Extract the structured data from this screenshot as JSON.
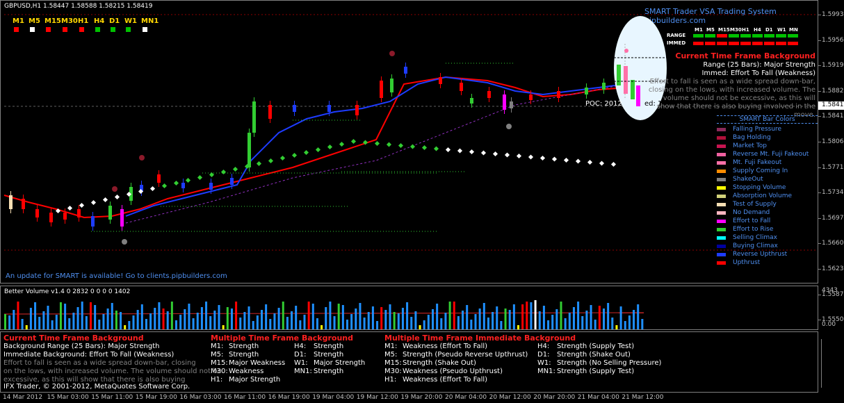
{
  "chart": {
    "symbol_header": "GBPUSD,H1  1.58447 1.58588 1.58215 1.58419",
    "update_notice": "An update for SMART is available! Go to clients.pipbuilders.com",
    "branding": "SMART Trader VSA Trading System pipbuilders.com",
    "poc_text": "POC: 2012",
    "poc_text2": "ed: 1.58546",
    "timeframes": [
      {
        "label": "M1",
        "color": "#ff0000"
      },
      {
        "label": "M5",
        "color": "#ffffff"
      },
      {
        "label": "M15",
        "color": "#ff0000"
      },
      {
        "label": "M30",
        "color": "#ff0000"
      },
      {
        "label": "H1",
        "color": "#ff0000"
      },
      {
        "label": "H4",
        "color": "#00c000"
      },
      {
        "label": "D1",
        "color": "#00c000"
      },
      {
        "label": "W1",
        "color": "#00c000"
      },
      {
        "label": "MN1",
        "color": "#ffffff"
      }
    ]
  },
  "matrix": {
    "headers": [
      "M1",
      "M5",
      "M15",
      "M30",
      "H1",
      "H4",
      "D1",
      "W1",
      "MN"
    ],
    "range_label": "RANGE",
    "immed_label": "IMMED",
    "range_colors": [
      "#00c000",
      "#00c000",
      "#ff0000",
      "#00c000",
      "#00c000",
      "#00c000",
      "#00c000",
      "#00c000",
      "#00c000"
    ],
    "immed_colors": [
      "#ff0000",
      "#ff0000",
      "#ff0000",
      "#ff0000",
      "#ff0000",
      "#ff0000",
      "#ff0000",
      "#ff0000",
      "#ff0000"
    ]
  },
  "background": {
    "title": "Current Time Frame Background",
    "range": "Range (25 Bars): Major Strength",
    "immed": "Immed: Effort To Fall (Weakness)",
    "desc1": "Effort to fall is seen as a wide spread down-bar,",
    "desc2": "closing on the lows, with increased volume. The",
    "desc3": "volume should not be excessive, as this will",
    "desc4": "show that there is also buying involved in the",
    "desc5": "move."
  },
  "legend": {
    "title": "SMART Bar Colors",
    "items": [
      {
        "label": "Falling Pressure",
        "color": "#8b2a5a"
      },
      {
        "label": "Bag Holding",
        "color": "#b0103a"
      },
      {
        "label": "Market Top",
        "color": "#c81450"
      },
      {
        "label": "Reverse Mt. Fuji Fakeout",
        "color": "#f060a0"
      },
      {
        "label": "Mt. Fuji Fakeout",
        "color": "#ff70a8"
      },
      {
        "label": "Supply Coming In",
        "color": "#ff8c00"
      },
      {
        "label": "ShakeOut",
        "color": "#808080"
      },
      {
        "label": "Stopping Volume",
        "color": "#ffff00"
      },
      {
        "label": "Absorption Volume",
        "color": "#d2d27a"
      },
      {
        "label": "Test of Supply",
        "color": "#f5deb3"
      },
      {
        "label": "No Demand",
        "color": "#ffb6c1"
      },
      {
        "label": "Effort to Fall",
        "color": "#ff00ff"
      },
      {
        "label": "Effort to Rise",
        "color": "#32cd32"
      },
      {
        "label": "Selling Climax",
        "color": "#00ffff"
      },
      {
        "label": "Buying Climax",
        "color": "#0000a0"
      },
      {
        "label": "Reverse Upthrust",
        "color": "#1e3cff"
      },
      {
        "label": "Upthrust",
        "color": "#ff0000"
      }
    ]
  },
  "price_axis": [
    "1.59930",
    "1.59565",
    "1.59190",
    "1.58820",
    "1.58419",
    "1.58060",
    "1.57710",
    "1.57340",
    "1.56970",
    "1.56600",
    "1.56230",
    "1.55870",
    "1.55500"
  ],
  "volume": {
    "title": "Better Volume v1.4 0 2832 0 0 0 0 1402",
    "scale_top": "4343",
    "scale_bottom": "0.00"
  },
  "info": {
    "ctf_title": "Current Time Frame Background",
    "ctf_l1": "Background Range (25 Bars): Major Strength",
    "ctf_l2": "Immediate Background: Effort To Fall (Weakness)",
    "ctf_l3": "Effort to fall is seen as a wide spread down-bar, closing",
    "ctf_l4": "on the lows, with increased volume. The volume should not be",
    "ctf_l5": "excessive, as this will show that there is also buying",
    "copyright": "IFX Trader, © 2001-2012, MetaQuotes Software Corp.",
    "mtf_title": "Multiple Time Frame Background",
    "mtf": [
      [
        "M1:",
        "Strength",
        "H4:",
        "Strength"
      ],
      [
        "M5:",
        "Strength",
        "D1:",
        "Strength"
      ],
      [
        "M15:",
        "Major Weakness",
        "W1:",
        "Major Strength"
      ],
      [
        "M30:",
        "Weakness",
        "MN1:",
        "Strength"
      ],
      [
        "H1:",
        "Major Strength",
        "",
        ""
      ]
    ],
    "mtfi_title": "Multiple Time Frame Immediate Background",
    "mtfi": [
      [
        "M1:",
        "Weakness (Effort To Fall)",
        "H4:",
        "Strength (Supply Test)"
      ],
      [
        "M5:",
        "Strength (Pseudo Reverse Upthrust)",
        "D1:",
        "Strength (Shake Out)"
      ],
      [
        "M15:",
        "Strength (Shake Out)",
        "W1:",
        "Strength (No Selling Pressure)"
      ],
      [
        "M30:",
        "Weakness (Pseudo Upthrust)",
        "MN1:",
        "Strength (Supply Test)"
      ],
      [
        "H1:",
        "Weakness (Effort To Fall)",
        "",
        ""
      ]
    ]
  },
  "time_axis": [
    "14 Mar 2012",
    "15 Mar 03:00",
    "15 Mar 11:00",
    "15 Mar 19:00",
    "16 Mar 03:00",
    "16 Mar 11:00",
    "16 Mar 19:00",
    "19 Mar 04:00",
    "19 Mar 12:00",
    "19 Mar 20:00",
    "20 Mar 04:00",
    "20 Mar 12:00",
    "20 Mar 20:00",
    "21 Mar 04:00",
    "21 Mar 12:00"
  ],
  "current_price": "1.58419"
}
